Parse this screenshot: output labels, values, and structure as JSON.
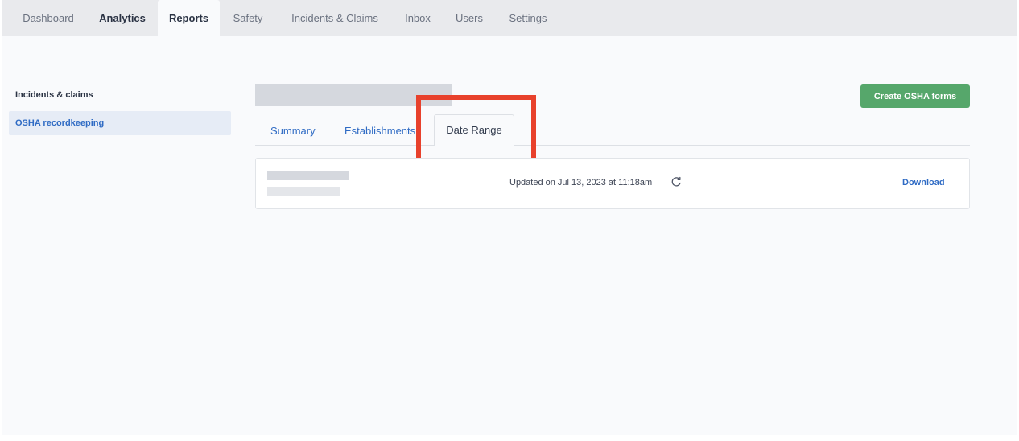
{
  "topnav": {
    "tabs": [
      {
        "label": "Dashboard"
      },
      {
        "label": "Analytics"
      },
      {
        "label": "Reports"
      },
      {
        "label": "Safety"
      },
      {
        "label": "Incidents & Claims"
      },
      {
        "label": "Inbox"
      },
      {
        "label": "Users"
      },
      {
        "label": "Settings"
      }
    ],
    "active_tab": "Reports"
  },
  "sidebar": {
    "heading": "Incidents & claims",
    "items": [
      {
        "label": "OSHA recordkeeping",
        "selected": true
      }
    ]
  },
  "main": {
    "create_button_label": "Create OSHA forms",
    "tabs": [
      {
        "label": "Summary"
      },
      {
        "label": "Establishments"
      },
      {
        "label": "Date Range"
      }
    ],
    "active_tab": "Date Range",
    "report": {
      "updated_text": "Updated on Jul 13, 2023 at 11:18am",
      "refresh_icon": "refresh-icon",
      "download_label": "Download"
    }
  },
  "colors": {
    "accent_blue": "#2f6bc4",
    "button_green": "#56a76b",
    "highlight_red": "#e8412c"
  }
}
